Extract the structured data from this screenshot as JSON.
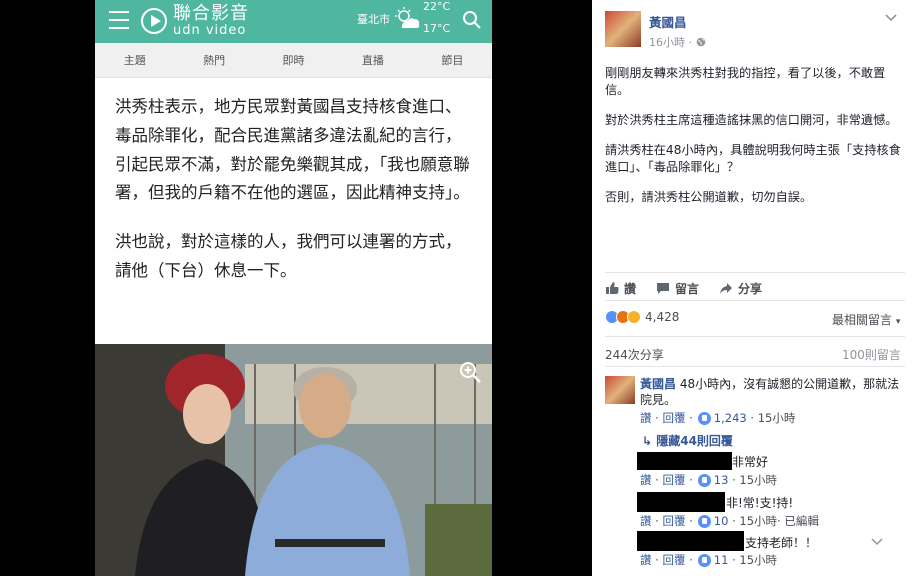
{
  "app": {
    "cn_name": "聯合影音",
    "en_name": "udn video",
    "city": "臺北市",
    "temp_high": "22°C",
    "temp_low": "17°C"
  },
  "tabs": [
    "主題",
    "熱門",
    "即時",
    "直播",
    "節目"
  ],
  "article": {
    "paragraphs": [
      "洪秀柱表示，地方民眾對黃國昌支持核食進口、毒品除罪化，配合民進黨諸多違法亂紀的言行，引起民眾不滿，對於罷免樂觀其成，「我也願意聯署，但我的戶籍不在他的選區，因此精神支持」。",
      "洪也說，對於這樣的人，我們可以連署的方式，請他（下台）休息一下。"
    ]
  },
  "post": {
    "author": "黃國昌",
    "time": "16小時 · ",
    "paragraphs": [
      "剛剛朋友轉來洪秀柱對我的指控，看了以後，不敢置信。",
      "對於洪秀柱主席這種造謠抹黑的信口開河，非常遺憾。",
      "請洪秀柱在48小時內，具體說明我何時主張「支持核食進口」、「毒品除罪化」？",
      "否則，請洪秀柱公開道歉，切勿自誤。"
    ],
    "actions": {
      "like": "讚",
      "comment": "留言",
      "share": "分享"
    },
    "reaction_count": "4,428",
    "sort_label": "最相關留言",
    "shares": "244次分享",
    "comment_count": "100則留言"
  },
  "comments": {
    "main": {
      "author": "黃國昌",
      "text": " 48小時內，沒有誠懇的公開道歉，那就法院見。",
      "like": "讚",
      "reply": "回覆",
      "likes": "1,243",
      "time": "15小時"
    },
    "hidden_replies": "隱藏44則回覆",
    "replies": [
      {
        "text": "非常好",
        "like": "讚",
        "reply": "回覆",
        "likes": "13",
        "time": "15小時",
        "extra": ""
      },
      {
        "text": "非!常!支!持!",
        "like": "讚",
        "reply": "回覆",
        "likes": "10",
        "time": "15小時",
        "extra": " · 已編輯"
      },
      {
        "text": "支持老師！！",
        "like": "讚",
        "reply": "回覆",
        "likes": "11",
        "time": "15小時",
        "extra": ""
      }
    ]
  },
  "colors": {
    "brand": "#4fb7a0",
    "fb_link": "#365899",
    "fb_like": "#5890ff"
  },
  "icons": [
    "menu-icon",
    "play-logo-icon",
    "weather-icon",
    "search-icon",
    "zoom-icon",
    "globe-icon",
    "chevron-down-icon",
    "like-icon",
    "comment-icon",
    "share-icon"
  ]
}
